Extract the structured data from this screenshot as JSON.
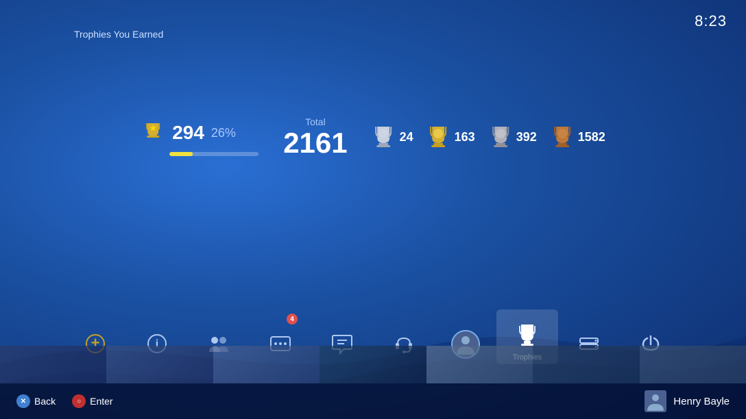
{
  "time": "8:23",
  "header": {
    "earned_label": "Trophies You Earned"
  },
  "stats": {
    "level": "294",
    "level_percent": "26%",
    "progress_percent": 26,
    "total_label": "Total",
    "total": "2161",
    "platinum_count": "24",
    "gold_count": "163",
    "silver_count": "392",
    "bronze_count": "1582"
  },
  "nav": {
    "items": [
      {
        "id": "psplus",
        "label": "",
        "icon": "plus",
        "active": false
      },
      {
        "id": "info",
        "label": "",
        "icon": "info",
        "active": false
      },
      {
        "id": "friends",
        "label": "",
        "icon": "friends",
        "active": false,
        "badge": null
      },
      {
        "id": "messages",
        "label": "",
        "icon": "messages",
        "active": false,
        "badge": null
      },
      {
        "id": "notifications",
        "label": "",
        "icon": "notifications",
        "active": false,
        "badge": "4"
      },
      {
        "id": "chat",
        "label": "",
        "icon": "chat",
        "active": false
      },
      {
        "id": "headset",
        "label": "",
        "icon": "headset",
        "active": false
      },
      {
        "id": "avatar",
        "label": "",
        "icon": "avatar",
        "active": false
      },
      {
        "id": "trophies",
        "label": "Trophies",
        "icon": "trophies",
        "active": true
      },
      {
        "id": "storage",
        "label": "",
        "icon": "storage",
        "active": false
      },
      {
        "id": "power",
        "label": "",
        "icon": "power",
        "active": false
      }
    ]
  },
  "controls": {
    "back_label": "Back",
    "enter_label": "Enter"
  },
  "user": {
    "name": "Henry Bayle"
  }
}
